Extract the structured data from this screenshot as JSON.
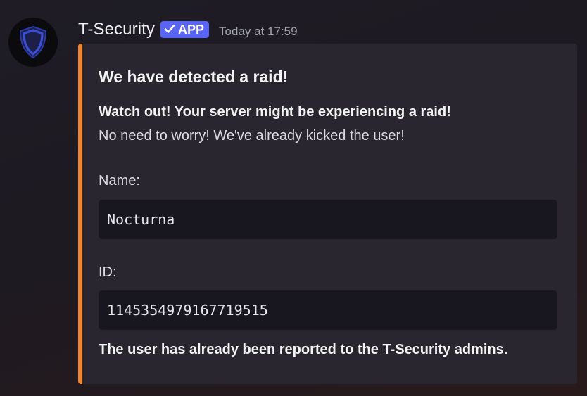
{
  "message": {
    "author": "T-Security",
    "badge": {
      "label": "APP",
      "icon": "checkmark-icon",
      "color": "#5865f2"
    },
    "timestamp": "Today at 17:59",
    "avatar_icon": "shield-icon"
  },
  "embed": {
    "accent_color": "#f0852f",
    "title": "We have detected a raid!",
    "description_bold": "Watch out! Your server might be experiencing a raid!",
    "description": "No need to worry! We've already kicked the user!",
    "fields": [
      {
        "label": "Name:",
        "value": "Nocturna"
      },
      {
        "label": "ID:",
        "value": "1145354979167719515"
      }
    ],
    "footer_text": "The user has already been reported to the T-Security admins."
  }
}
